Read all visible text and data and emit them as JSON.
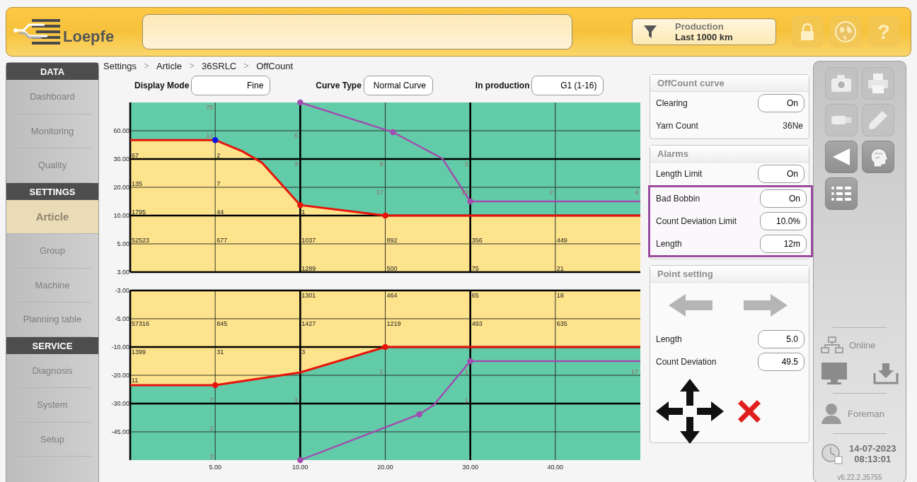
{
  "header": {
    "logo": "Loepfe",
    "production_button": {
      "title": "Production",
      "subtitle": "Last 1000 km"
    },
    "buttons": [
      {
        "kind": "lock",
        "disabled": true
      },
      {
        "kind": "globe",
        "disabled": true
      },
      {
        "kind": "help",
        "label": "?",
        "disabled": true
      }
    ]
  },
  "sidebar": {
    "sections": [
      {
        "title": "DATA",
        "items": [
          {
            "label": "Dashboard",
            "selected": false
          },
          {
            "label": "Monitoring",
            "selected": false
          },
          {
            "label": "Quality",
            "selected": false
          }
        ]
      },
      {
        "title": "SETTINGS",
        "items": [
          {
            "label": "Article",
            "selected": true
          },
          {
            "label": "Group",
            "selected": false
          },
          {
            "label": "Machine",
            "selected": false
          },
          {
            "label": "Planning table",
            "selected": false
          }
        ]
      },
      {
        "title": "SERVICE",
        "items": [
          {
            "label": "Diagnosis",
            "selected": false
          },
          {
            "label": "System",
            "selected": false
          },
          {
            "label": "Setup",
            "selected": false
          }
        ]
      }
    ]
  },
  "breadcrumb": [
    "Settings",
    "Article",
    "36SRLC",
    "OffCount"
  ],
  "controls": [
    {
      "label": "Display Mode",
      "value": "Fine"
    },
    {
      "label": "Curve Type",
      "value": "Normal Curve"
    },
    {
      "label": "In production",
      "value": "G1 (1-16)"
    }
  ],
  "charts": [
    {
      "kind": "upper",
      "y_labels": [
        "60.00",
        "30.00",
        "20.00",
        "10.00",
        "5.00",
        "3.00"
      ],
      "cell_counts": [
        [
          {
            "kind": "blank"
          },
          {
            "text": "75",
            "kind": "cut"
          }
        ],
        [
          {
            "kind": "blank"
          },
          {
            "text": "12",
            "kind": "cut"
          },
          {
            "text": "5",
            "kind": "cut"
          }
        ],
        [
          {
            "text": "67",
            "kind": "pass"
          },
          {
            "text": "2",
            "kind": "pass"
          },
          {
            "text": "3",
            "kind": "cut"
          },
          {
            "text": "9",
            "kind": "cut"
          },
          {
            "text": "3",
            "kind": "cut"
          }
        ],
        [
          {
            "text": "135",
            "kind": "pass"
          },
          {
            "text": "7",
            "kind": "pass"
          },
          {
            "kind": "blank"
          },
          {
            "text": "17",
            "kind": "cut"
          },
          {
            "text": "10",
            "kind": "cut"
          },
          {
            "text": "2",
            "kind": "cut"
          },
          {
            "text": "4",
            "kind": "cut"
          }
        ],
        [
          {
            "text": "1795",
            "kind": "pass"
          },
          {
            "text": "44",
            "kind": "pass"
          },
          {
            "text": "1",
            "kind": "pass"
          }
        ],
        [
          {
            "text": "52523",
            "kind": "pass"
          },
          {
            "text": "677",
            "kind": "pass"
          },
          {
            "text": "1037",
            "kind": "pass"
          },
          {
            "text": "892",
            "kind": "pass"
          },
          {
            "text": "356",
            "kind": "pass"
          },
          {
            "text": "449",
            "kind": "pass"
          }
        ],
        [
          {
            "kind": "blank"
          },
          {
            "kind": "blank"
          },
          {
            "text": "1289",
            "kind": "pass"
          },
          {
            "text": "500",
            "kind": "pass"
          },
          {
            "text": "75",
            "kind": "pass"
          },
          {
            "text": "21",
            "kind": "pass"
          }
        ]
      ]
    },
    {
      "kind": "lower",
      "y_labels": [
        "-3.00",
        "-5.00",
        "-10.00",
        "-20.00",
        "-30.00",
        "-45.00"
      ],
      "x_labels": [
        "5.00",
        "10.00",
        "20.00",
        "30.00",
        "40.00"
      ],
      "cell_counts": [
        [
          {
            "kind": "blank"
          },
          {
            "kind": "blank"
          },
          {
            "text": "1301",
            "kind": "pass"
          },
          {
            "text": "464",
            "kind": "pass"
          },
          {
            "text": "65",
            "kind": "pass"
          },
          {
            "text": "18",
            "kind": "pass"
          }
        ],
        [
          {
            "text": "57316",
            "kind": "pass"
          },
          {
            "text": "845",
            "kind": "pass"
          },
          {
            "text": "1427",
            "kind": "pass"
          },
          {
            "text": "1219",
            "kind": "pass"
          },
          {
            "text": "493",
            "kind": "pass"
          },
          {
            "text": "635",
            "kind": "pass"
          }
        ],
        [
          {
            "text": "1399",
            "kind": "pass"
          },
          {
            "text": "31",
            "kind": "pass"
          },
          {
            "text": "3",
            "kind": "pass"
          }
        ],
        [
          {
            "text": "11",
            "kind": "pass"
          },
          {
            "kind": "blank"
          },
          {
            "kind": "blank"
          },
          {
            "text": "2",
            "kind": "cut"
          },
          {
            "text": "1",
            "kind": "cut"
          },
          {
            "kind": "blank"
          },
          {
            "text": "17",
            "kind": "cut"
          }
        ],
        [
          {
            "kind": "blank"
          },
          {
            "text": "7",
            "kind": "cut"
          },
          {
            "text": "1",
            "kind": "cut"
          },
          {
            "kind": "blank"
          },
          {
            "text": "1",
            "kind": "cut"
          }
        ],
        [
          {
            "kind": "blank"
          },
          {
            "text": "2",
            "kind": "cut"
          }
        ],
        [
          {
            "kind": "blank"
          },
          {
            "text": "3",
            "kind": "cut"
          }
        ]
      ]
    }
  ],
  "offcount_panel": {
    "title": "OffCount curve",
    "rows": [
      {
        "label": "Clearing",
        "value": "On",
        "kind": "field",
        "highlighted": false
      },
      {
        "label": "Yarn Count",
        "value": "36Ne",
        "kind": "text",
        "highlighted": false
      }
    ]
  },
  "alarms_panel": {
    "title": "Alarms",
    "rows": [
      {
        "label": "Length Limit",
        "value": "On",
        "kind": "field",
        "highlighted": false
      },
      {
        "label": "Bad Bobbin",
        "value": "On",
        "kind": "field",
        "highlighted": true
      },
      {
        "label": "Count Deviation Limit",
        "value": "10.0%",
        "kind": "field",
        "highlighted": true
      },
      {
        "label": "Length",
        "value": "12m",
        "kind": "field",
        "highlighted": true
      }
    ]
  },
  "point_setting": {
    "title": "Point setting",
    "fields": [
      {
        "label": "Length",
        "value": "5.0"
      },
      {
        "label": "Count Deviation",
        "value": "49.5"
      }
    ]
  },
  "toolbar": {
    "buttons": [
      {
        "kind": "camera",
        "disabled": true
      },
      {
        "kind": "printer",
        "disabled": true
      },
      {
        "kind": "usb",
        "disabled": true
      },
      {
        "kind": "pencil",
        "disabled": true
      },
      {
        "kind": "back",
        "disabled": false
      },
      {
        "kind": "head",
        "disabled": false
      },
      {
        "kind": "list",
        "disabled": false
      }
    ],
    "connection": "Online",
    "user": "Foreman",
    "date": "14-07-2023",
    "time": "08:13:01",
    "version": "v6.22.2.35755"
  }
}
